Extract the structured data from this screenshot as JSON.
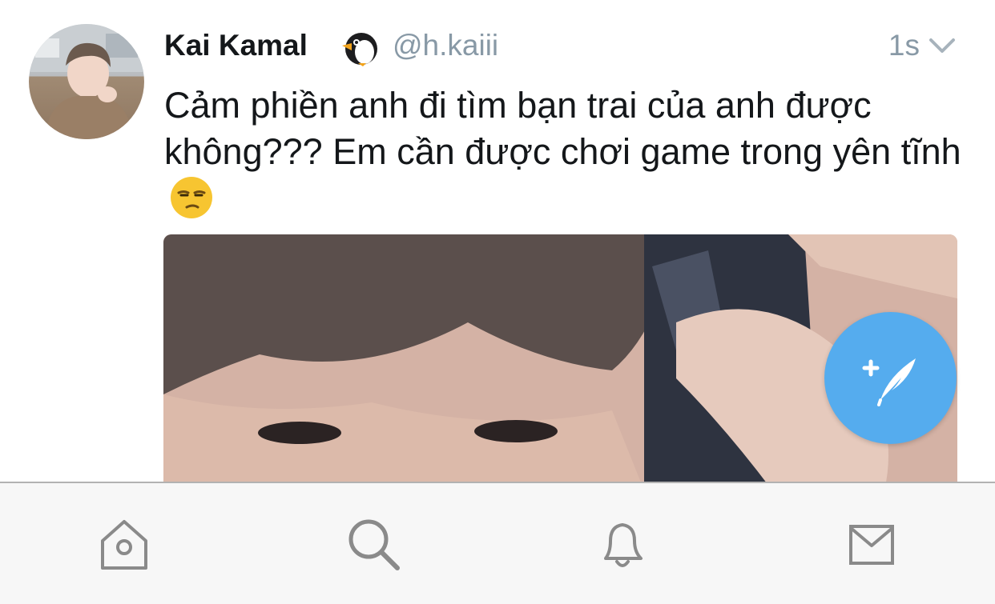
{
  "tweet": {
    "display_name": "Kai Kamal",
    "handle": "@h.kaiii",
    "timestamp": "1s",
    "text": "Cảm phiền anh đi tìm bạn trai của anh được không??? Em cần được chơi game trong yên tĩnh",
    "name_emoji": "penguin-icon",
    "text_emoji": "unamused-face-emoji"
  },
  "colors": {
    "accent": "#55acee",
    "secondary_text": "#8899a6",
    "primary_text": "#14171a",
    "tabbar_bg": "#f7f7f7",
    "tab_icon": "#8a8a8a"
  },
  "tabbar": {
    "items": [
      {
        "icon": "home-icon"
      },
      {
        "icon": "search-icon"
      },
      {
        "icon": "notifications-bell-icon"
      },
      {
        "icon": "messages-envelope-icon"
      }
    ]
  },
  "compose_button": {
    "icon": "compose-tweet-icon"
  }
}
